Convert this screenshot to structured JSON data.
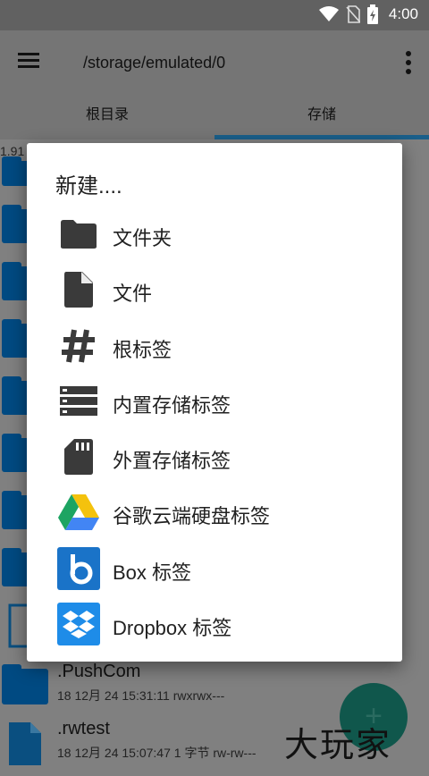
{
  "status": {
    "time": "4:00",
    "icons": [
      "wifi-icon",
      "no-sim-icon",
      "battery-charging-icon"
    ]
  },
  "appbar": {
    "path": "/storage/emulated/0",
    "menu_icon": "hamburger-menu-icon",
    "more_icon": "more-vert-icon"
  },
  "tabs": [
    {
      "label": "根目录"
    },
    {
      "label": "存储"
    }
  ],
  "list": {
    "partial_left": "1.91",
    "rows": [
      {
        "name": ".PushCom",
        "meta": "18 12月 24 15:31:11   rwxrwx---"
      },
      {
        "name": ".rwtest",
        "meta": "18 12月 24 15:07:47  1 字节  rw-rw---"
      }
    ]
  },
  "dialog": {
    "title": "新建....",
    "items": [
      {
        "label": "文件夹",
        "icon": "folder-icon"
      },
      {
        "label": "文件",
        "icon": "file-icon"
      },
      {
        "label": "根标签",
        "icon": "hash-icon"
      },
      {
        "label": "内置存储标签",
        "icon": "internal-storage-icon"
      },
      {
        "label": "外置存储标签",
        "icon": "sd-card-icon"
      },
      {
        "label": "谷歌云端硬盘标签",
        "icon": "google-drive-icon"
      },
      {
        "label": "Box 标签",
        "icon": "box-icon"
      },
      {
        "label": "Dropbox 标签",
        "icon": "dropbox-icon"
      }
    ]
  },
  "fab": {
    "label": "+"
  },
  "watermark": "大玩家",
  "colors": {
    "accent": "#1a5f8a",
    "folder": "#004a82",
    "fab": "#10574c",
    "icon_dark": "#3a3a3a"
  }
}
